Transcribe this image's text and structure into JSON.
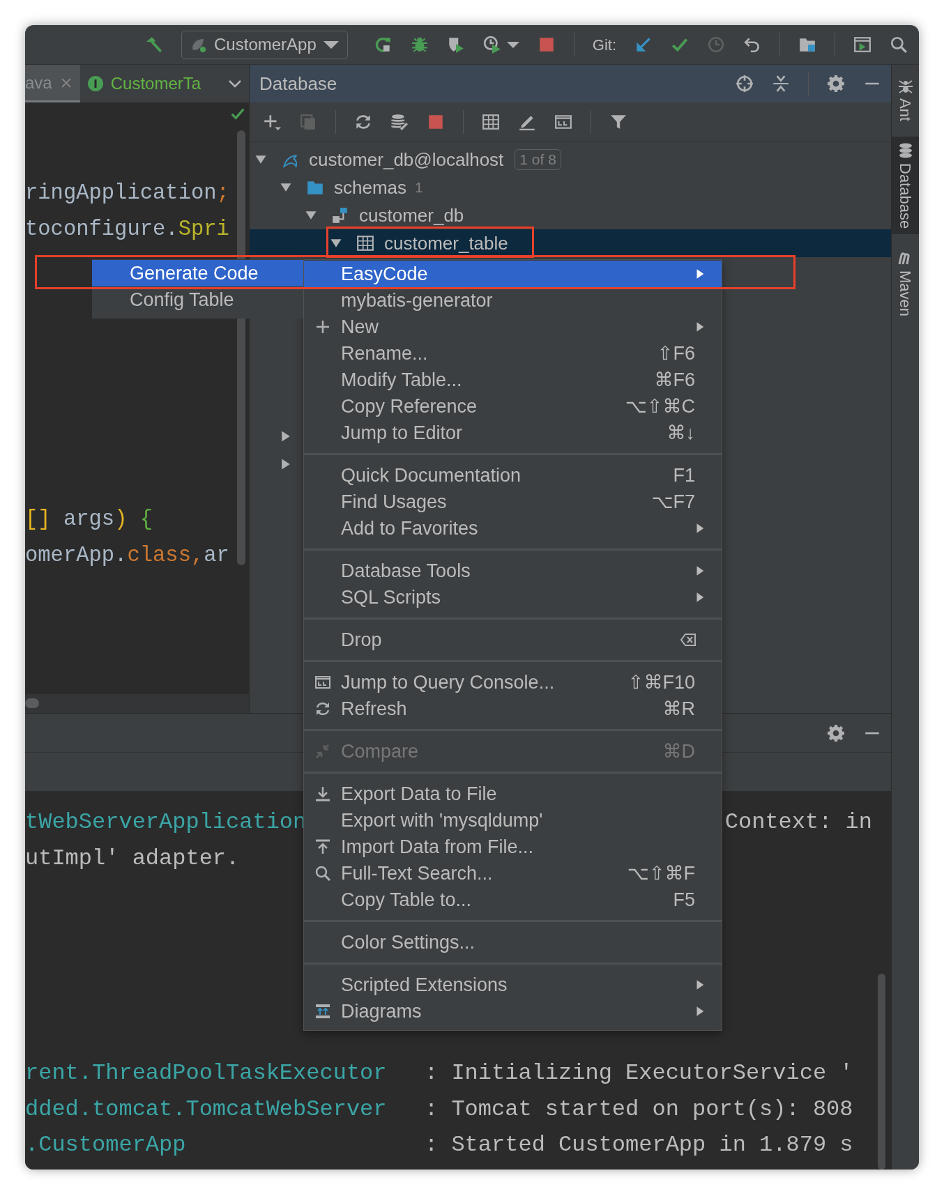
{
  "toolbar": {
    "run_config": "CustomerApp",
    "git_label": "Git:"
  },
  "editor_tabs": [
    {
      "label": "ava",
      "selected": true,
      "closable": true
    },
    {
      "label": "CustomerTa",
      "selected": false,
      "closable": false
    }
  ],
  "editor": {
    "blocks": [
      [
        {
          "tokens": [
            {
              "kind": "text",
              "text": "ringApplication"
            },
            {
              "kind": "keyword",
              "text": ";"
            }
          ]
        },
        {
          "tokens": [
            {
              "kind": "text",
              "text": "toconfigure."
            },
            {
              "kind": "class",
              "text": "Spri"
            }
          ]
        }
      ],
      [
        {
          "tokens": [
            {
              "kind": "bracket",
              "text": "[]"
            },
            {
              "kind": "text",
              "text": " args"
            },
            {
              "kind": "bracket",
              "text": ")"
            },
            {
              "kind": "brace",
              "text": " {"
            }
          ]
        },
        {
          "tokens": [
            {
              "kind": "text",
              "text": "omerApp."
            },
            {
              "kind": "keyword",
              "text": "class,"
            },
            {
              "kind": "text",
              "text": "ar"
            }
          ]
        }
      ]
    ]
  },
  "database": {
    "title": "Database",
    "tree": [
      {
        "label": "customer_db@localhost",
        "badge": "1 of 8",
        "expanded": true,
        "selected": false,
        "children": [
          {
            "label": "schemas",
            "count": "1",
            "expanded": true,
            "selected": false,
            "children": [
              {
                "label": "customer_db",
                "expanded": true,
                "selected": false,
                "children": [
                  {
                    "label": "customer_table",
                    "expanded": true,
                    "selected": true
                  }
                ]
              }
            ]
          },
          {
            "expanded": false,
            "selected": false
          },
          {
            "expanded": false,
            "selected": false
          }
        ]
      }
    ]
  },
  "submenu": {
    "items": [
      {
        "label": "Generate Code",
        "selected": true
      },
      {
        "label": "Config Table",
        "selected": false
      }
    ]
  },
  "context_menu": {
    "items": [
      {
        "kind": "item",
        "label": "EasyCode",
        "submenu": true,
        "selected": true,
        "disabled": false
      },
      {
        "kind": "item",
        "label": "mybatis-generator",
        "submenu": false,
        "selected": false,
        "disabled": false
      },
      {
        "kind": "item",
        "label": "New",
        "submenu": true,
        "selected": false,
        "disabled": false
      },
      {
        "kind": "item",
        "label": "Rename...",
        "shortcut": "⇧F6",
        "submenu": false,
        "selected": false,
        "disabled": false
      },
      {
        "kind": "item",
        "label": "Modify Table...",
        "shortcut": "⌘F6",
        "submenu": false,
        "selected": false,
        "disabled": false
      },
      {
        "kind": "item",
        "label": "Copy Reference",
        "shortcut": "⌥⇧⌘C",
        "submenu": false,
        "selected": false,
        "disabled": false
      },
      {
        "kind": "item",
        "label": "Jump to Editor",
        "shortcut": "⌘↓",
        "submenu": false,
        "selected": false,
        "disabled": false
      },
      {
        "kind": "separator"
      },
      {
        "kind": "item",
        "label": "Quick Documentation",
        "shortcut": "F1",
        "submenu": false,
        "selected": false,
        "disabled": false
      },
      {
        "kind": "item",
        "label": "Find Usages",
        "shortcut": "⌥F7",
        "submenu": false,
        "selected": false,
        "disabled": false
      },
      {
        "kind": "item",
        "label": "Add to Favorites",
        "submenu": true,
        "selected": false,
        "disabled": false
      },
      {
        "kind": "separator"
      },
      {
        "kind": "item",
        "label": "Database Tools",
        "submenu": true,
        "selected": false,
        "disabled": false
      },
      {
        "kind": "item",
        "label": "SQL Scripts",
        "submenu": true,
        "selected": false,
        "disabled": false
      },
      {
        "kind": "separator"
      },
      {
        "kind": "item",
        "label": "Drop",
        "submenu": false,
        "selected": false,
        "disabled": false
      },
      {
        "kind": "separator"
      },
      {
        "kind": "item",
        "label": "Jump to Query Console...",
        "shortcut": "⇧⌘F10",
        "submenu": false,
        "selected": false,
        "disabled": false
      },
      {
        "kind": "item",
        "label": "Refresh",
        "shortcut": "⌘R",
        "submenu": false,
        "selected": false,
        "disabled": false
      },
      {
        "kind": "separator"
      },
      {
        "kind": "item",
        "label": "Compare",
        "shortcut": "⌘D",
        "submenu": false,
        "selected": false,
        "disabled": true
      },
      {
        "kind": "separator"
      },
      {
        "kind": "item",
        "label": "Export Data to File",
        "submenu": false,
        "selected": false,
        "disabled": false
      },
      {
        "kind": "item",
        "label": "Export with 'mysqldump'",
        "submenu": false,
        "selected": false,
        "disabled": false
      },
      {
        "kind": "item",
        "label": "Import Data from File...",
        "submenu": false,
        "selected": false,
        "disabled": false
      },
      {
        "kind": "item",
        "label": "Full-Text Search...",
        "shortcut": "⌥⇧⌘F",
        "submenu": false,
        "selected": false,
        "disabled": false
      },
      {
        "kind": "item",
        "label": "Copy Table to...",
        "shortcut": "F5",
        "submenu": false,
        "selected": false,
        "disabled": false
      },
      {
        "kind": "separator"
      },
      {
        "kind": "item",
        "label": "Color Settings...",
        "submenu": false,
        "selected": false,
        "disabled": false
      },
      {
        "kind": "separator"
      },
      {
        "kind": "item",
        "label": "Scripted Extensions",
        "submenu": true,
        "selected": false,
        "disabled": false
      },
      {
        "kind": "item",
        "label": "Diagrams",
        "submenu": true,
        "selected": false,
        "disabled": false
      }
    ]
  },
  "annotations": [
    {
      "kind": "frame"
    },
    {
      "kind": "frame"
    }
  ],
  "console": [
    {
      "kind": "split",
      "left": "tWebServerApplication",
      "right": "Context: in"
    },
    {
      "kind": "plain",
      "text": "utImpl' adapter."
    },
    {
      "kind": "log",
      "logger": "rent.ThreadPoolTaskExecutor",
      "message": ": Initializing ExecutorService '"
    },
    {
      "kind": "log",
      "logger": "dded.tomcat.TomcatWebServer",
      "message": ": Tomcat started on port(s): 808"
    },
    {
      "kind": "log",
      "logger": ".CustomerApp",
      "message": ": Started CustomerApp in 1.879 s"
    }
  ],
  "side_strip": [
    {
      "label": "Ant",
      "selected": false
    },
    {
      "label": "Database",
      "selected": true
    },
    {
      "label": "Maven",
      "selected": false
    }
  ]
}
